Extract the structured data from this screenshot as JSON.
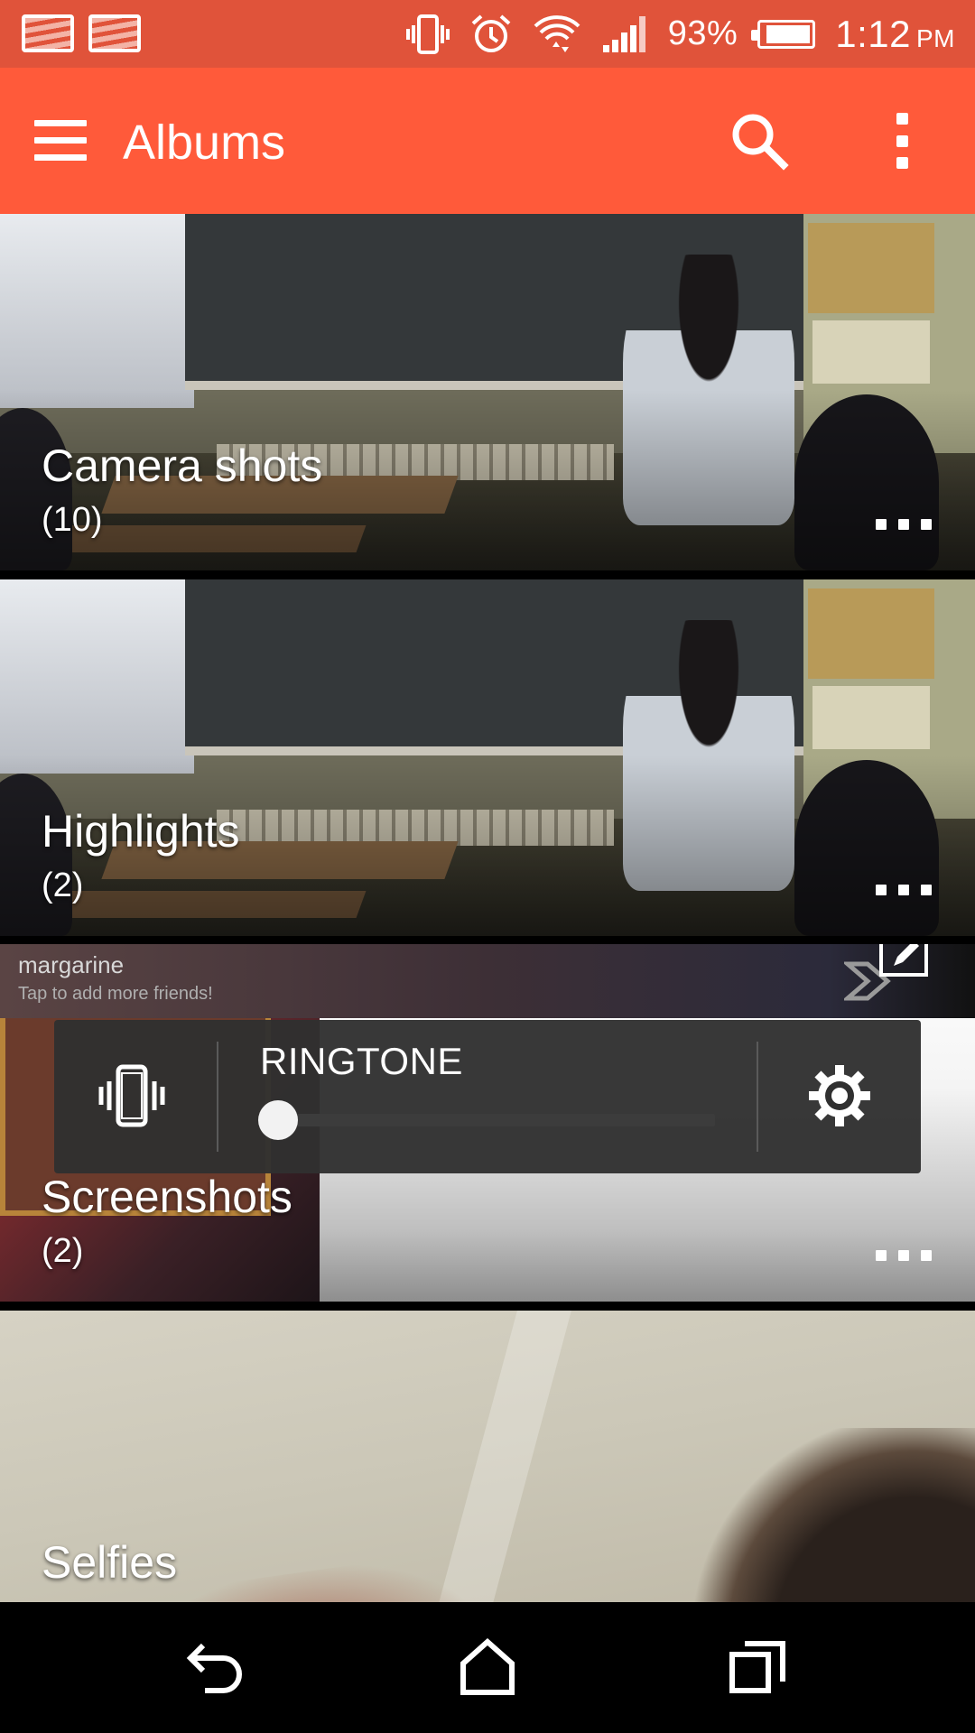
{
  "status_bar": {
    "battery_percent": "93%",
    "battery_level": 0.93,
    "time": "1:12",
    "ampm": "PM",
    "icons": [
      "gallery-notification-icon",
      "gallery-notification-icon",
      "vibrate-icon",
      "alarm-icon",
      "wifi-icon",
      "signal-icon",
      "battery-icon"
    ]
  },
  "app_bar": {
    "title": "Albums",
    "icons": [
      "menu-icon",
      "search-icon",
      "overflow-icon"
    ],
    "background": "#FF5A3A"
  },
  "albums": [
    {
      "name": "Camera shots",
      "count": "(10)"
    },
    {
      "name": "Highlights",
      "count": "(2)"
    },
    {
      "name": "Screenshots",
      "count": "(2)"
    },
    {
      "name": "Selfies"
    }
  ],
  "chat_notification": {
    "name": "margarine",
    "subtitle": "Tap to add more friends!"
  },
  "volume_panel": {
    "label": "RINGTONE",
    "level": 0,
    "icons": [
      "vibrate-icon",
      "gear-icon"
    ]
  },
  "nav_bar": {
    "icons": [
      "back-icon",
      "home-icon",
      "recents-icon"
    ]
  },
  "colors": {
    "status_bar": "#E0533A",
    "accent": "#FF5A3A"
  }
}
